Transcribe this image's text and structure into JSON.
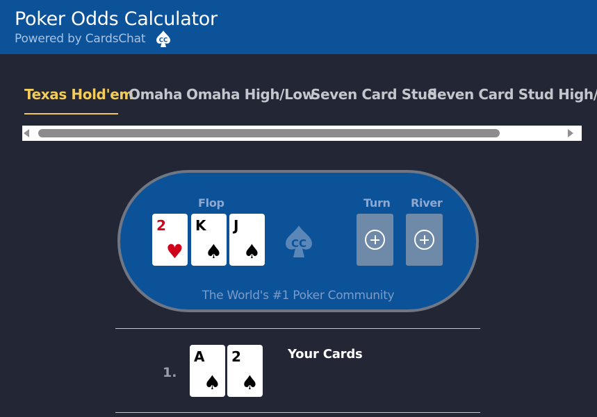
{
  "header": {
    "title": "Poker Odds Calculator",
    "subtitle": "Powered by CardsChat",
    "logo_icon": "cardschat-spade-logo",
    "background": "#0b5299"
  },
  "tabs": {
    "items": [
      {
        "label": "Texas Hold'em",
        "active": true
      },
      {
        "label": "Omaha",
        "active": false
      },
      {
        "label": "Omaha High/Low",
        "active": false
      },
      {
        "label": "Seven Card Stud",
        "active": false
      },
      {
        "label": "Seven Card Stud High/L",
        "active": false
      }
    ],
    "active_color": "#f2cb5b"
  },
  "board": {
    "flop_label": "Flop",
    "turn_label": "Turn",
    "river_label": "River",
    "flop_cards": [
      {
        "rank": "2",
        "suit": "♥",
        "color": "red"
      },
      {
        "rank": "K",
        "suit": "♠",
        "color": "black"
      },
      {
        "rank": "J",
        "suit": "♠",
        "color": "black"
      }
    ],
    "turn_card": "add-card-icon",
    "river_card": "add-card-icon",
    "tagline": "The World's #1 Poker Community"
  },
  "players": [
    {
      "number": "1.",
      "label": "Your Cards",
      "cards": [
        {
          "rank": "A",
          "suit": "♠",
          "color": "black"
        },
        {
          "rank": "2",
          "suit": "♠",
          "color": "black"
        }
      ]
    }
  ]
}
